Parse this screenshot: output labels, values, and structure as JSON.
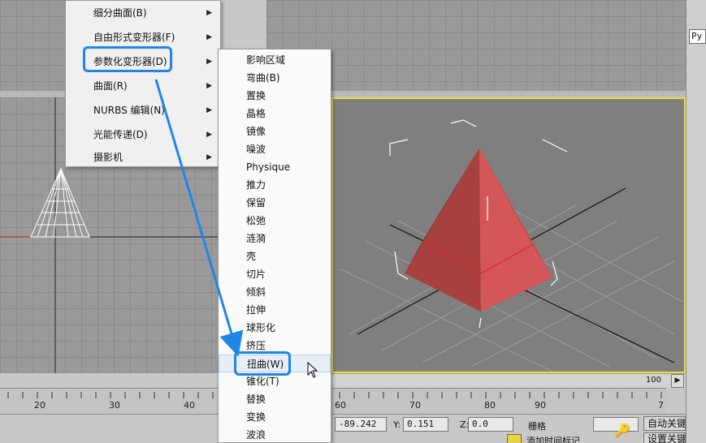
{
  "main_menu": {
    "items": [
      {
        "label": "细分曲面(B)"
      },
      {
        "label": "自由形式变形器(F)"
      },
      {
        "label": "参数化变形器(D)"
      },
      {
        "label": "曲面(R)"
      },
      {
        "label": "NURBS 编辑(N)"
      },
      {
        "label": "光能传递(D)"
      },
      {
        "label": "摄影机"
      }
    ],
    "selected_index": 2
  },
  "sub_menu": {
    "items": [
      {
        "label": "影响区域"
      },
      {
        "label": "弯曲(B)"
      },
      {
        "label": "置换"
      },
      {
        "label": "晶格"
      },
      {
        "label": "镜像"
      },
      {
        "label": "噪波"
      },
      {
        "label": "Physique"
      },
      {
        "label": "推力"
      },
      {
        "label": "保留"
      },
      {
        "label": "松弛"
      },
      {
        "label": "涟漪"
      },
      {
        "label": "壳"
      },
      {
        "label": "切片"
      },
      {
        "label": "倾斜"
      },
      {
        "label": "拉伸"
      },
      {
        "label": "球形化"
      },
      {
        "label": "挤压"
      },
      {
        "label": "扭曲(W)"
      },
      {
        "label": "锥化(T)"
      },
      {
        "label": "替换"
      },
      {
        "label": "变换"
      },
      {
        "label": "波浪"
      }
    ],
    "highlighted_index": 17
  },
  "ruler": {
    "ticks": [
      "20",
      "30",
      "40",
      "60",
      "70",
      "80",
      "90",
      "7"
    ]
  },
  "time_slider": {
    "frame_label": "100"
  },
  "status": {
    "x_value": "-89.242",
    "y_label": "Y:",
    "y_value": "0.151",
    "z_label": "Z:",
    "z_value": "0.0",
    "grid_label": "栅格",
    "auto_key_label": "自动关键点",
    "set_key_label": "设置关键点",
    "add_time_tag_label": "添加时间标记"
  },
  "right_panel": {
    "field_value": "Py"
  },
  "colors": {
    "highlight_blue": "#1f86e6",
    "viewport_gray": "#9a9a9a",
    "active_viewport_border": "#e8e43a",
    "pyramid_red": "#c94848"
  },
  "icons": [
    "submenu-arrow-icon",
    "mouse-cursor-icon",
    "key-icon",
    "time-tag-icon"
  ]
}
